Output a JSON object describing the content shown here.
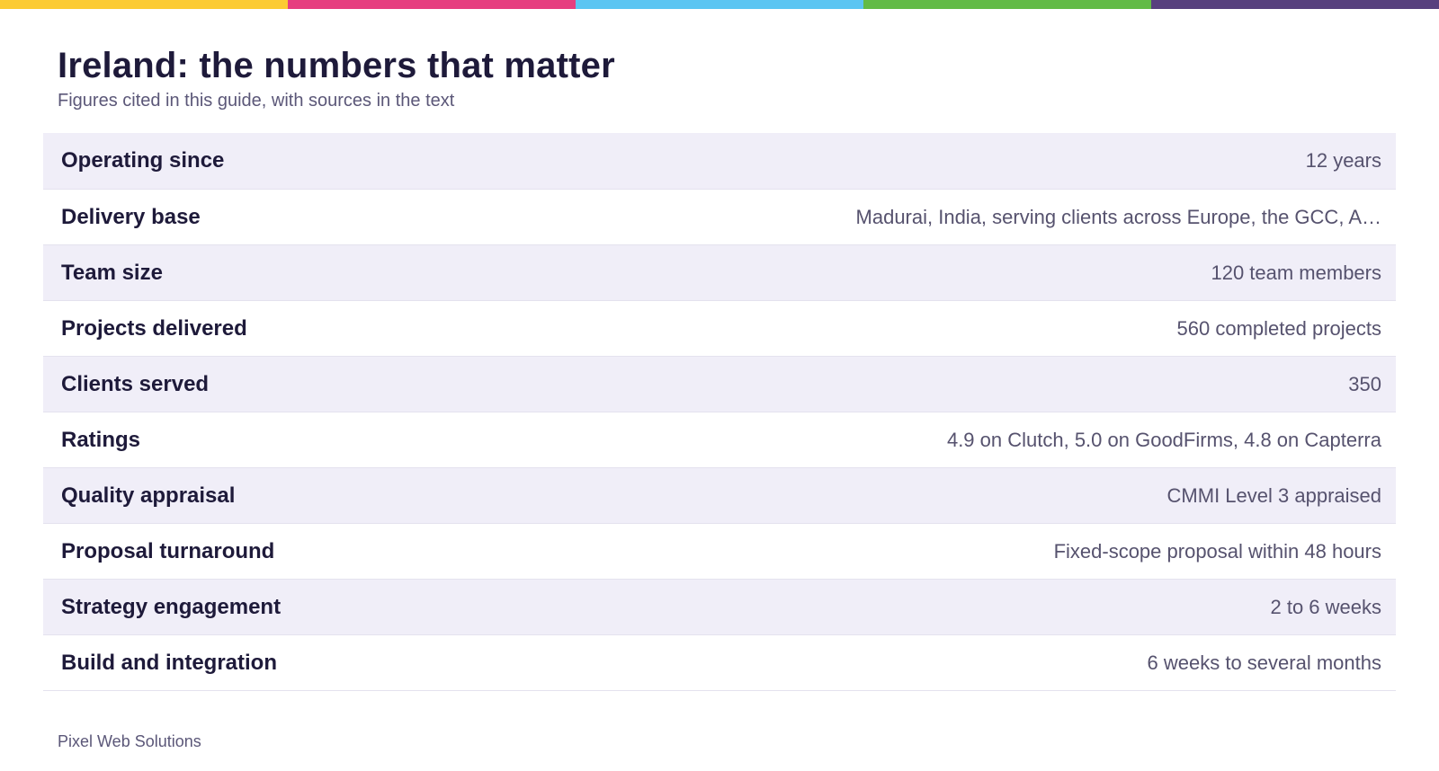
{
  "stripe_colors": [
    "#fccb33",
    "#e63e7f",
    "#5bc5f2",
    "#62bb46",
    "#57407e"
  ],
  "header": {
    "title": "Ireland: the numbers that matter",
    "subtitle": "Figures cited in this guide, with sources in the text"
  },
  "rows": [
    {
      "label": "Operating since",
      "value": "12 years"
    },
    {
      "label": "Delivery base",
      "value": "Madurai, India, serving clients across Europe, the GCC, A…"
    },
    {
      "label": "Team size",
      "value": "120 team members"
    },
    {
      "label": "Projects delivered",
      "value": "560 completed projects"
    },
    {
      "label": "Clients served",
      "value": "350"
    },
    {
      "label": "Ratings",
      "value": "4.9 on Clutch, 5.0 on GoodFirms, 4.8 on Capterra"
    },
    {
      "label": "Quality appraisal",
      "value": "CMMI Level 3 appraised"
    },
    {
      "label": "Proposal turnaround",
      "value": "Fixed-scope proposal within 48 hours"
    },
    {
      "label": "Strategy engagement",
      "value": "2 to 6 weeks"
    },
    {
      "label": "Build and integration",
      "value": "6 weeks to several months"
    }
  ],
  "footer": {
    "brand": "Pixel Web Solutions"
  }
}
